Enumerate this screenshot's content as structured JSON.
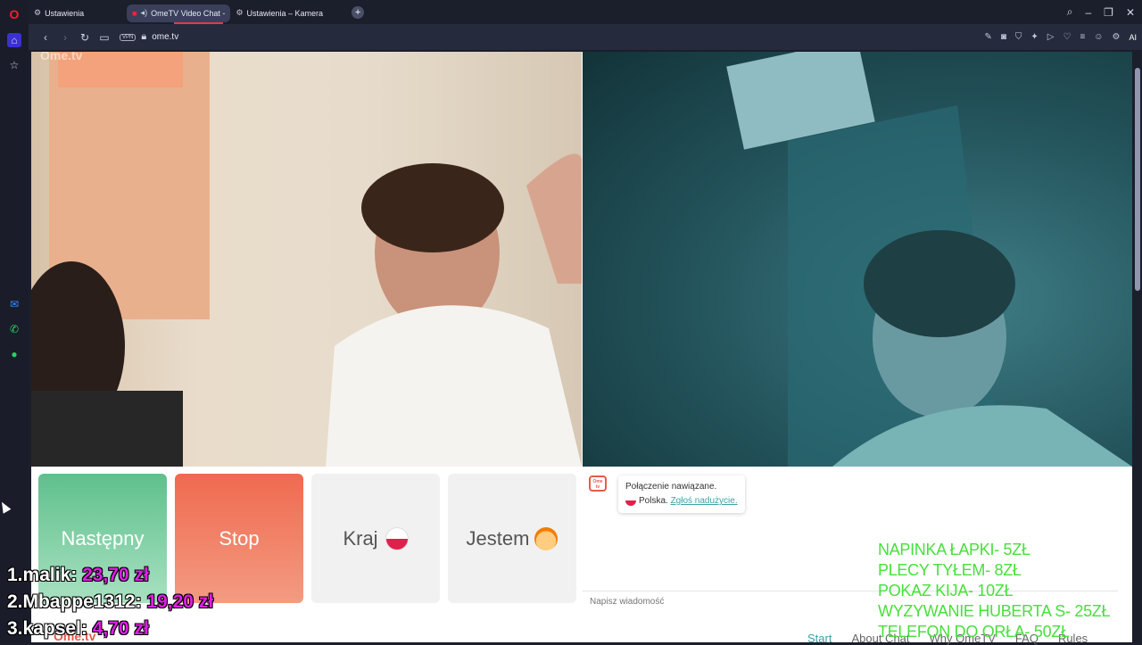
{
  "tabs": [
    {
      "label": "Ustawienia",
      "icon": "gear-icon"
    },
    {
      "label": "OmeTV Video Chat -",
      "icon": "ometv-icon",
      "active": true
    },
    {
      "label": "Ustawienia – Kamera",
      "icon": "gear-icon"
    }
  ],
  "address": {
    "vpn": "VPN",
    "url": "ome.tv",
    "ai": "AI"
  },
  "buttons": {
    "next": "Następny",
    "stop": "Stop",
    "country": "Kraj",
    "gender": "Jestem"
  },
  "video": {
    "watermark": "Ome.tv"
  },
  "chat": {
    "logo": "Ome tv",
    "status": "Połączenie nawiązane.",
    "country": "Polska.",
    "report": "Zgłoś nadużycie.",
    "placeholder": "Napisz wiadomość"
  },
  "footer": {
    "links": [
      "Start",
      "About Chat",
      "Why OmeTV",
      "FAQ",
      "Rules"
    ],
    "logo": "Ome.tv"
  },
  "leaderboard": [
    {
      "rank": "1.",
      "name": "malik:",
      "amount": "23,70 zł"
    },
    {
      "rank": "2.",
      "name": "Mbappe1312:",
      "amount": "19,20 zł"
    },
    {
      "rank": "3.",
      "name": "kapsel:",
      "amount": "4,70 zł"
    }
  ],
  "pricelist": [
    "NAPINKA ŁAPKI- 5ZŁ",
    "PLECY TYŁEM- 8ZŁ",
    "POKAZ KIJA- 10ZŁ",
    "WYZYWANIE HUBERTA S- 25ZŁ",
    "TELEFON DO ORŁA- 50ZŁ"
  ],
  "colors": {
    "next": "#5fc08c",
    "stop": "#ef6a4f",
    "accent": "#3ba2a5",
    "overlay_green": "#47e03a",
    "overlay_pink": "#e01ee6"
  }
}
